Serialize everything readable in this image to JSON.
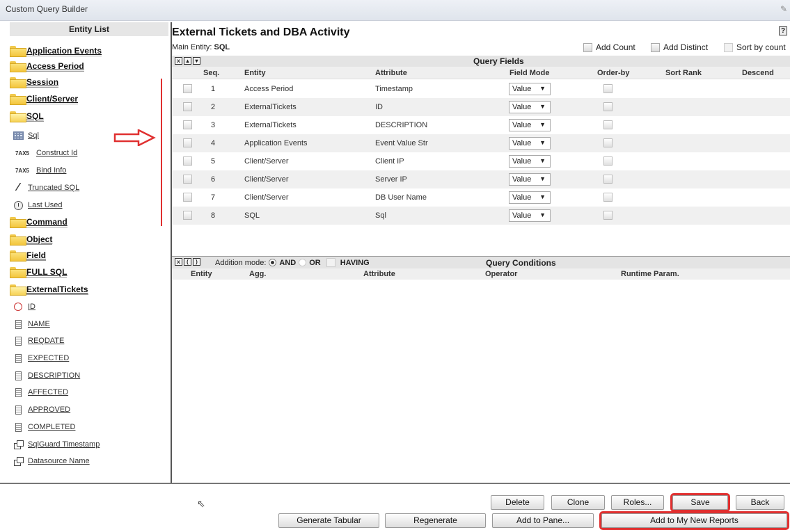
{
  "window": {
    "title": "Custom Query Builder"
  },
  "sidebar": {
    "header": "Entity List",
    "items": [
      {
        "label": "Application Events",
        "kind": "entity"
      },
      {
        "label": "Access Period",
        "kind": "entity"
      },
      {
        "label": "Session",
        "kind": "entity"
      },
      {
        "label": "Client/Server",
        "kind": "entity"
      },
      {
        "label": "SQL",
        "kind": "entity-open"
      },
      {
        "label": "Sql",
        "kind": "attr",
        "icon": "grid-icon"
      },
      {
        "label": "Construct Id",
        "kind": "attr",
        "icon": "7AX5"
      },
      {
        "label": "Bind Info",
        "kind": "attr",
        "icon": "7AX5"
      },
      {
        "label": "Truncated SQL",
        "kind": "attr",
        "icon": "truncate-icon"
      },
      {
        "label": "Last Used",
        "kind": "attr",
        "icon": "clock-icon"
      },
      {
        "label": "Command",
        "kind": "entity"
      },
      {
        "label": "Object",
        "kind": "entity"
      },
      {
        "label": "Field",
        "kind": "entity"
      },
      {
        "label": "FULL SQL",
        "kind": "entity"
      },
      {
        "label": "ExternalTickets",
        "kind": "entity-open"
      },
      {
        "label": "ID",
        "kind": "attr",
        "icon": "circle-icon"
      },
      {
        "label": "NAME",
        "kind": "attr",
        "icon": "bar-icon"
      },
      {
        "label": "REQDATE",
        "kind": "attr",
        "icon": "bar-icon"
      },
      {
        "label": "EXPECTED",
        "kind": "attr",
        "icon": "bar-icon"
      },
      {
        "label": "DESCRIPTION",
        "kind": "attr",
        "icon": "bar-icon"
      },
      {
        "label": "AFFECTED",
        "kind": "attr",
        "icon": "bar-icon"
      },
      {
        "label": "APPROVED",
        "kind": "attr",
        "icon": "bar-icon"
      },
      {
        "label": "COMPLETED",
        "kind": "attr",
        "icon": "bar-icon"
      },
      {
        "label": "SqlGuard Timestamp",
        "kind": "attr",
        "icon": "double-box-icon"
      },
      {
        "label": "Datasource Name",
        "kind": "attr",
        "icon": "double-box-icon"
      }
    ]
  },
  "main": {
    "title": "External Tickets and DBA Activity",
    "help": "?",
    "main_entity_label": "Main Entity:",
    "main_entity_value": "SQL",
    "options": {
      "add_count": "Add Count",
      "add_distinct": "Add Distinct",
      "sort_by_count": "Sort by count"
    },
    "query_fields": {
      "title": "Query Fields",
      "columns": {
        "seq": "Seq.",
        "entity": "Entity",
        "attribute": "Attribute",
        "field_mode": "Field Mode",
        "order_by": "Order-by",
        "sort_rank": "Sort Rank",
        "descend": "Descend"
      },
      "rows": [
        {
          "seq": "1",
          "entity": "Access Period",
          "attribute": "Timestamp",
          "mode": "Value"
        },
        {
          "seq": "2",
          "entity": "ExternalTickets",
          "attribute": "ID",
          "mode": "Value"
        },
        {
          "seq": "3",
          "entity": "ExternalTickets",
          "attribute": "DESCRIPTION",
          "mode": "Value"
        },
        {
          "seq": "4",
          "entity": "Application Events",
          "attribute": "Event Value Str",
          "mode": "Value"
        },
        {
          "seq": "5",
          "entity": "Client/Server",
          "attribute": "Client IP",
          "mode": "Value"
        },
        {
          "seq": "6",
          "entity": "Client/Server",
          "attribute": "Server IP",
          "mode": "Value"
        },
        {
          "seq": "7",
          "entity": "Client/Server",
          "attribute": "DB User Name",
          "mode": "Value"
        },
        {
          "seq": "8",
          "entity": "SQL",
          "attribute": "Sql",
          "mode": "Value"
        }
      ]
    },
    "query_conditions": {
      "title": "Query Conditions",
      "addition_mode_label": "Addition mode:",
      "and_label": "AND",
      "or_label": "OR",
      "having_label": "HAVING",
      "columns": {
        "entity": "Entity",
        "agg": "Agg.",
        "attribute": "Attribute",
        "operator": "Operator",
        "runtime_param": "Runtime Param."
      }
    }
  },
  "footer": {
    "delete": "Delete",
    "clone": "Clone",
    "roles": "Roles...",
    "save": "Save",
    "back": "Back",
    "generate_tabular": "Generate Tabular",
    "regenerate": "Regenerate",
    "add_to_pane": "Add to Pane...",
    "add_to_reports": "Add to My New Reports"
  }
}
